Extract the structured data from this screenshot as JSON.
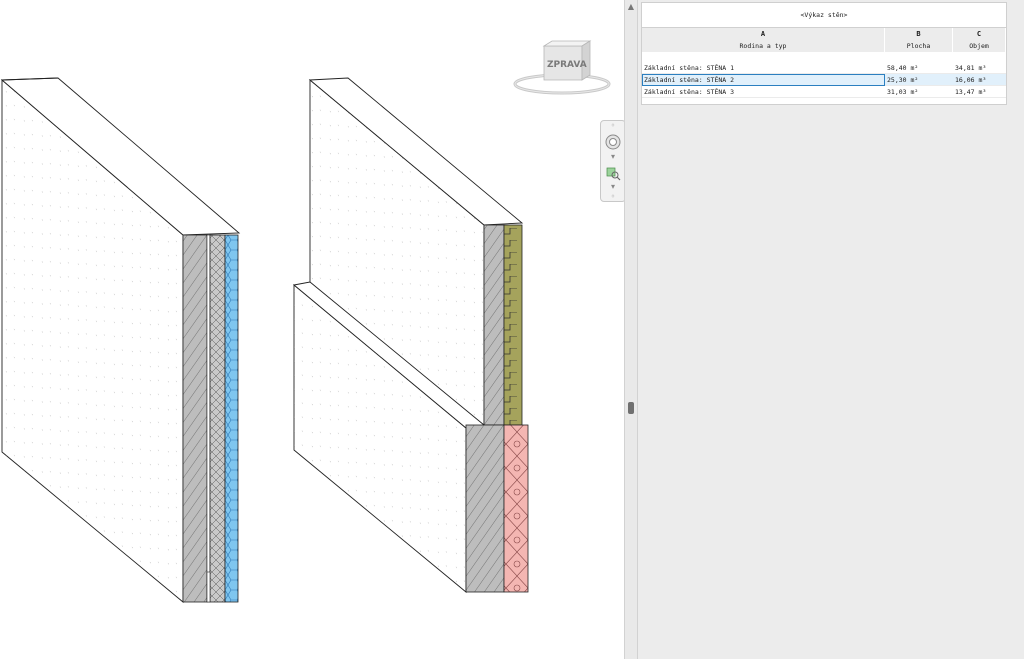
{
  "viewcube": {
    "face_label": "ZPRAVA"
  },
  "navbar": {
    "items": [
      "wheel-icon",
      "zoom-icon"
    ]
  },
  "schedule": {
    "title": "<Výkaz stěn>",
    "column_letters": [
      "A",
      "B",
      "C"
    ],
    "column_names": [
      "Rodina a typ",
      "Plocha",
      "Objem"
    ],
    "rows": [
      {
        "type": "Základní stěna: STĚNA 1",
        "area": "58,40 m²",
        "volume": "34,81 m³",
        "selected": false
      },
      {
        "type": "Základní stěna: STĚNA 2",
        "area": "25,30 m²",
        "volume": "16,06 m³",
        "selected": true
      },
      {
        "type": "Základní stěna: STĚNA 3",
        "area": "31,03 m²",
        "volume": "13,47 m³",
        "selected": false
      }
    ]
  },
  "colors": {
    "concrete": "#bdbdbd",
    "insulation_blue": "#7fc6ef",
    "olive_layer": "#a5a35c",
    "pink_layer": "#f4b6b2",
    "selection": "#2b7fc0"
  }
}
